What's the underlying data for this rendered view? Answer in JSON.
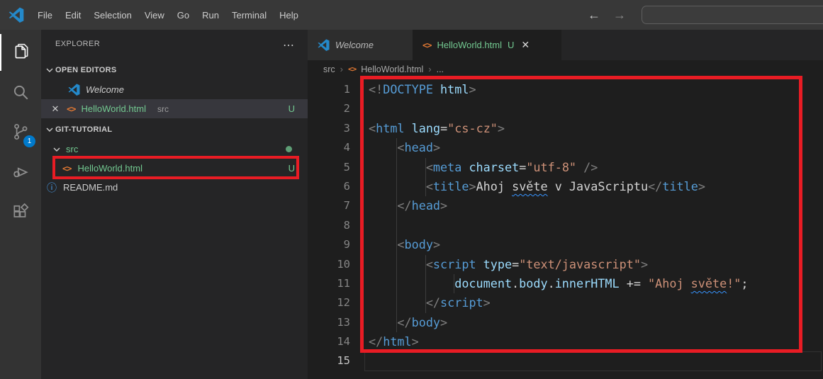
{
  "colors": {
    "annotation_red": "#e81c24",
    "git_untracked_green": "#73c991",
    "badge_blue": "#007acc",
    "tag_blue": "#569cd6",
    "attr_blue": "#9cdcfe",
    "string_orange": "#ce9178"
  },
  "titlebar": {
    "menus": [
      "File",
      "Edit",
      "Selection",
      "View",
      "Go",
      "Run",
      "Terminal",
      "Help"
    ],
    "back_glyph": "←",
    "forward_glyph": "→",
    "command_center_value": ""
  },
  "activitybar": {
    "scm_badge": "1"
  },
  "sidebar": {
    "header": "EXPLORER",
    "header_actions_glyph": "⋯",
    "open_editors": {
      "label": "OPEN EDITORS",
      "welcome_label": "Welcome",
      "file_label": "HelloWorld.html",
      "file_detail": "src",
      "file_badge": "U",
      "close_glyph": "✕",
      "file_icon_glyph": "<>"
    },
    "project": {
      "label": "GIT-TUTORIAL",
      "folder_label": "src",
      "file_label": "HelloWorld.html",
      "file_badge": "U",
      "file_icon_glyph": "<>",
      "readme_label": "README.md",
      "readme_icon_glyph": "ⓘ"
    }
  },
  "tabs": {
    "welcome_label": "Welcome",
    "file_label": "HelloWorld.html",
    "file_badge": "U",
    "file_icon_glyph": "<>",
    "close_glyph": "✕"
  },
  "breadcrumb": {
    "item1": "src",
    "item2": "HelloWorld.html",
    "item3": "...",
    "separator": "›",
    "file_icon_glyph": "<>"
  },
  "editor": {
    "lines": [
      {
        "n": "1",
        "ind": 0,
        "tokens": [
          {
            "c": "p",
            "t": "<!"
          },
          {
            "c": "tag",
            "t": "DOCTYPE"
          },
          {
            "c": "attr",
            "t": " html"
          },
          {
            "c": "p",
            "t": ">"
          }
        ]
      },
      {
        "n": "2",
        "ind": 0,
        "tokens": []
      },
      {
        "n": "3",
        "ind": 0,
        "tokens": [
          {
            "c": "p",
            "t": "<"
          },
          {
            "c": "tag",
            "t": "html"
          },
          {
            "c": "text",
            "t": " "
          },
          {
            "c": "attr",
            "t": "lang"
          },
          {
            "c": "text",
            "t": "="
          },
          {
            "c": "str",
            "t": "\"cs-cz\""
          },
          {
            "c": "p",
            "t": ">"
          }
        ]
      },
      {
        "n": "4",
        "ind": 1,
        "tokens": [
          {
            "c": "p",
            "t": "<"
          },
          {
            "c": "tag",
            "t": "head"
          },
          {
            "c": "p",
            "t": ">"
          }
        ]
      },
      {
        "n": "5",
        "ind": 2,
        "tokens": [
          {
            "c": "p",
            "t": "<"
          },
          {
            "c": "tag",
            "t": "meta"
          },
          {
            "c": "text",
            "t": " "
          },
          {
            "c": "attr",
            "t": "charset"
          },
          {
            "c": "text",
            "t": "="
          },
          {
            "c": "str",
            "t": "\"utf-8\""
          },
          {
            "c": "text",
            "t": " "
          },
          {
            "c": "p",
            "t": "/>"
          }
        ]
      },
      {
        "n": "6",
        "ind": 2,
        "tokens": [
          {
            "c": "p",
            "t": "<"
          },
          {
            "c": "tag",
            "t": "title"
          },
          {
            "c": "p",
            "t": ">"
          },
          {
            "c": "text",
            "t": "Ahoj "
          },
          {
            "c": "text",
            "t": "světe",
            "sq": true
          },
          {
            "c": "text",
            "t": " v JavaScriptu"
          },
          {
            "c": "p",
            "t": "</"
          },
          {
            "c": "tag",
            "t": "title"
          },
          {
            "c": "p",
            "t": ">"
          }
        ]
      },
      {
        "n": "7",
        "ind": 1,
        "tokens": [
          {
            "c": "p",
            "t": "</"
          },
          {
            "c": "tag",
            "t": "head"
          },
          {
            "c": "p",
            "t": ">"
          }
        ]
      },
      {
        "n": "8",
        "ind": 1,
        "tokens": []
      },
      {
        "n": "9",
        "ind": 1,
        "tokens": [
          {
            "c": "p",
            "t": "<"
          },
          {
            "c": "tag",
            "t": "body"
          },
          {
            "c": "p",
            "t": ">"
          }
        ]
      },
      {
        "n": "10",
        "ind": 2,
        "tokens": [
          {
            "c": "p",
            "t": "<"
          },
          {
            "c": "tag",
            "t": "script"
          },
          {
            "c": "text",
            "t": " "
          },
          {
            "c": "attr",
            "t": "type"
          },
          {
            "c": "text",
            "t": "="
          },
          {
            "c": "str",
            "t": "\"text/javascript\""
          },
          {
            "c": "p",
            "t": ">"
          }
        ]
      },
      {
        "n": "11",
        "ind": 3,
        "tokens": [
          {
            "c": "var",
            "t": "document"
          },
          {
            "c": "text",
            "t": "."
          },
          {
            "c": "var",
            "t": "body"
          },
          {
            "c": "text",
            "t": "."
          },
          {
            "c": "var",
            "t": "innerHTML"
          },
          {
            "c": "text",
            "t": " += "
          },
          {
            "c": "str",
            "t": "\"Ahoj "
          },
          {
            "c": "str",
            "t": "světe",
            "sq": true
          },
          {
            "c": "str",
            "t": "!\""
          },
          {
            "c": "text",
            "t": ";"
          }
        ]
      },
      {
        "n": "12",
        "ind": 2,
        "tokens": [
          {
            "c": "p",
            "t": "</"
          },
          {
            "c": "tag",
            "t": "script"
          },
          {
            "c": "p",
            "t": ">"
          }
        ]
      },
      {
        "n": "13",
        "ind": 1,
        "tokens": [
          {
            "c": "p",
            "t": "</"
          },
          {
            "c": "tag",
            "t": "body"
          },
          {
            "c": "p",
            "t": ">"
          }
        ]
      },
      {
        "n": "14",
        "ind": 0,
        "tokens": [
          {
            "c": "p",
            "t": "</"
          },
          {
            "c": "tag",
            "t": "html"
          },
          {
            "c": "p",
            "t": ">"
          }
        ]
      },
      {
        "n": "15",
        "ind": 0,
        "current": true,
        "tokens": []
      }
    ]
  }
}
